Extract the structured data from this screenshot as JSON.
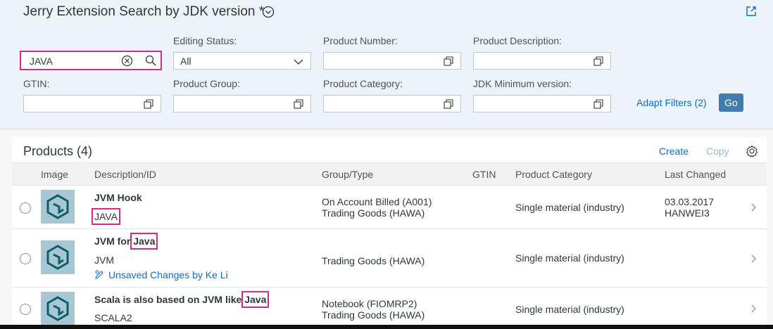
{
  "header": {
    "title": "Jerry Extension Search by JDK version *"
  },
  "filters": {
    "search_value": "JAVA",
    "editing_status_label": "Editing Status:",
    "editing_status_value": "All",
    "product_number_label": "Product Number:",
    "product_description_label": "Product Description:",
    "gtin_label": "GTIN:",
    "product_group_label": "Product Group:",
    "product_category_label": "Product Category:",
    "jdk_min_label": "JDK Minimum version:",
    "adapt_filters": "Adapt Filters (2)",
    "go": "Go"
  },
  "table": {
    "title": "Products (4)",
    "create": "Create",
    "copy": "Copy",
    "columns": [
      "Image",
      "Description/ID",
      "Group/Type",
      "GTIN",
      "Product Category",
      "Last Changed"
    ],
    "rows": [
      {
        "desc_name": "JVM Hook",
        "id": "JAVA",
        "group1": "On Account Billed (A001)",
        "group2": "Trading Goods (HAWA)",
        "gtin": "",
        "category": "Single material (industry)",
        "changed_date": "03.03.2017",
        "changed_by": "HANWEI3"
      },
      {
        "desc_prefix": "JVM for",
        "desc_hl": "Java",
        "id": "JVM",
        "unsaved": "Unsaved Changes by Ke Li",
        "group2": "Trading Goods (HAWA)",
        "gtin": "",
        "category": "Single material (industry)"
      },
      {
        "desc_prefix": "Scala is also based on JVM like",
        "desc_hl": "Java",
        "id": "SCALA2",
        "group1": "Notebook (FIOMRP2)",
        "group2": "Trading Goods (HAWA)",
        "gtin": "",
        "category": "Single material (industry)"
      }
    ]
  },
  "icons": {
    "title_chevron": "chevron-down-circle-icon",
    "share": "share-icon",
    "clear": "clear-circle-icon",
    "search": "search-icon",
    "value_help": "value-help-icon",
    "settings": "gear-icon",
    "nav": "chevron-right-icon",
    "edit": "edit-pencil-icon"
  },
  "colors": {
    "accent": "#0a6ed1",
    "highlight": "#d22c86",
    "go_button": "#427cac",
    "filterbar_bg": "#edf3fa"
  }
}
